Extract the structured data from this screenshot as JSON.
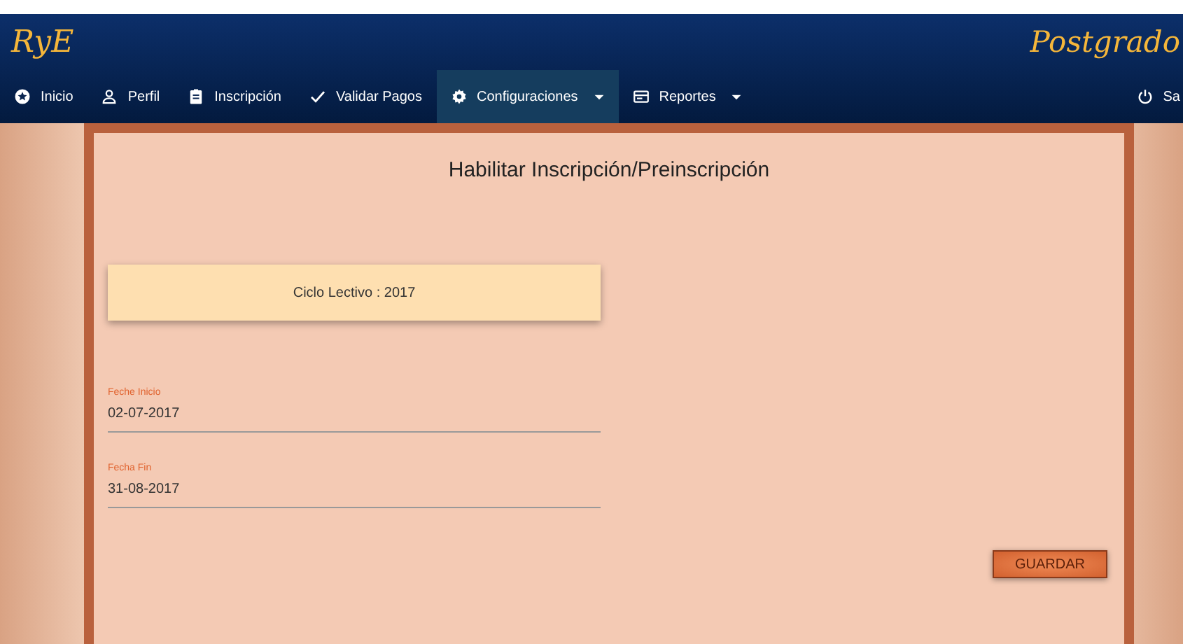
{
  "header": {
    "logo": "RyE",
    "brand": "Postgrado"
  },
  "nav": [
    {
      "label": "Inicio",
      "dropdown": false,
      "selected": false
    },
    {
      "label": "Perfil",
      "dropdown": false,
      "selected": false
    },
    {
      "label": "Inscripción",
      "dropdown": false,
      "selected": false
    },
    {
      "label": "Validar Pagos",
      "dropdown": false,
      "selected": false
    },
    {
      "label": "Configuraciones",
      "dropdown": true,
      "selected": true
    },
    {
      "label": "Reportes",
      "dropdown": true,
      "selected": false
    }
  ],
  "logout": {
    "label": "Sa"
  },
  "form": {
    "title": "Habilitar Inscripción/Preinscripción",
    "cycle": "Ciclo Lectivo : 2017",
    "fields": [
      {
        "label": "Feche Inicio",
        "value": "02-07-2017"
      },
      {
        "label": "Fecha Fin",
        "value": "31-08-2017"
      }
    ],
    "button": "GUARDAR"
  }
}
